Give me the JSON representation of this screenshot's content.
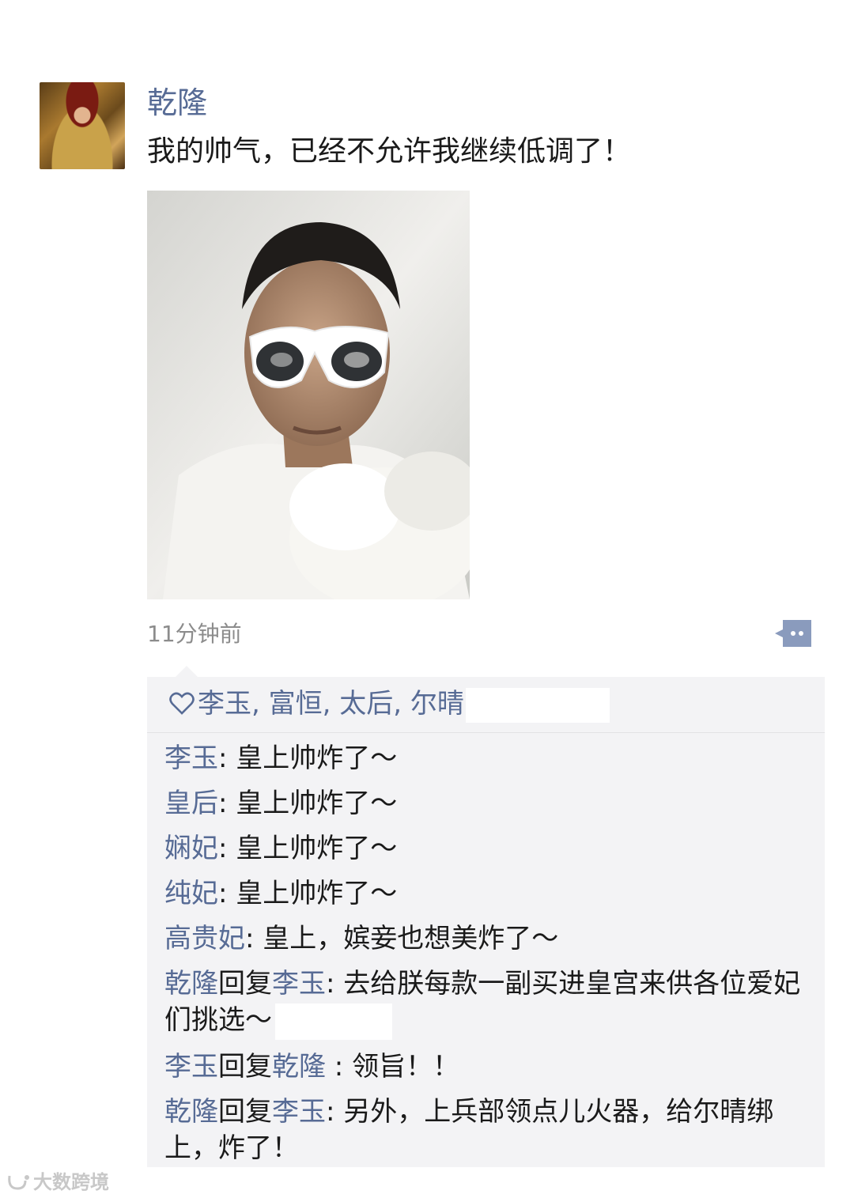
{
  "post": {
    "author": "乾隆",
    "text": "我的帅气，已经不允许我继续低调了！",
    "timestamp": "11分钟前",
    "avatar_icon": "avatar-emperor-portrait",
    "image_icon": "photo-man-sunglasses"
  },
  "likes": {
    "icon": "heart-outline-icon",
    "names": [
      "李玉",
      "富恒",
      "太后",
      "尔晴"
    ],
    "separator": ", "
  },
  "comments": [
    {
      "from": "李玉",
      "to": null,
      "text": ": 皇上帅炸了～"
    },
    {
      "from": "皇后",
      "to": null,
      "text": ": 皇上帅炸了～"
    },
    {
      "from": "娴妃",
      "to": null,
      "text": ": 皇上帅炸了～"
    },
    {
      "from": "纯妃",
      "to": null,
      "text": ": 皇上帅炸了～"
    },
    {
      "from": "高贵妃",
      "to": null,
      "text": ": 皇上，嫔妾也想美炸了～"
    },
    {
      "from": "乾隆",
      "to": "李玉",
      "text": ": 去给朕每款一副买进皇宫来供各位爱妃们挑选～"
    },
    {
      "from": "李玉",
      "to": "乾隆",
      "text": " : 领旨！！"
    },
    {
      "from": "乾隆",
      "to": "李玉",
      "text": ": 另外，上兵部领点儿火器，给尔晴绑上，炸了！"
    }
  ],
  "reply_word": "回复",
  "watermark": "大数跨境",
  "colors": {
    "name_blue": "#576b95",
    "comment_bg": "#f3f3f5",
    "timestamp_gray": "#8c8c8c"
  }
}
